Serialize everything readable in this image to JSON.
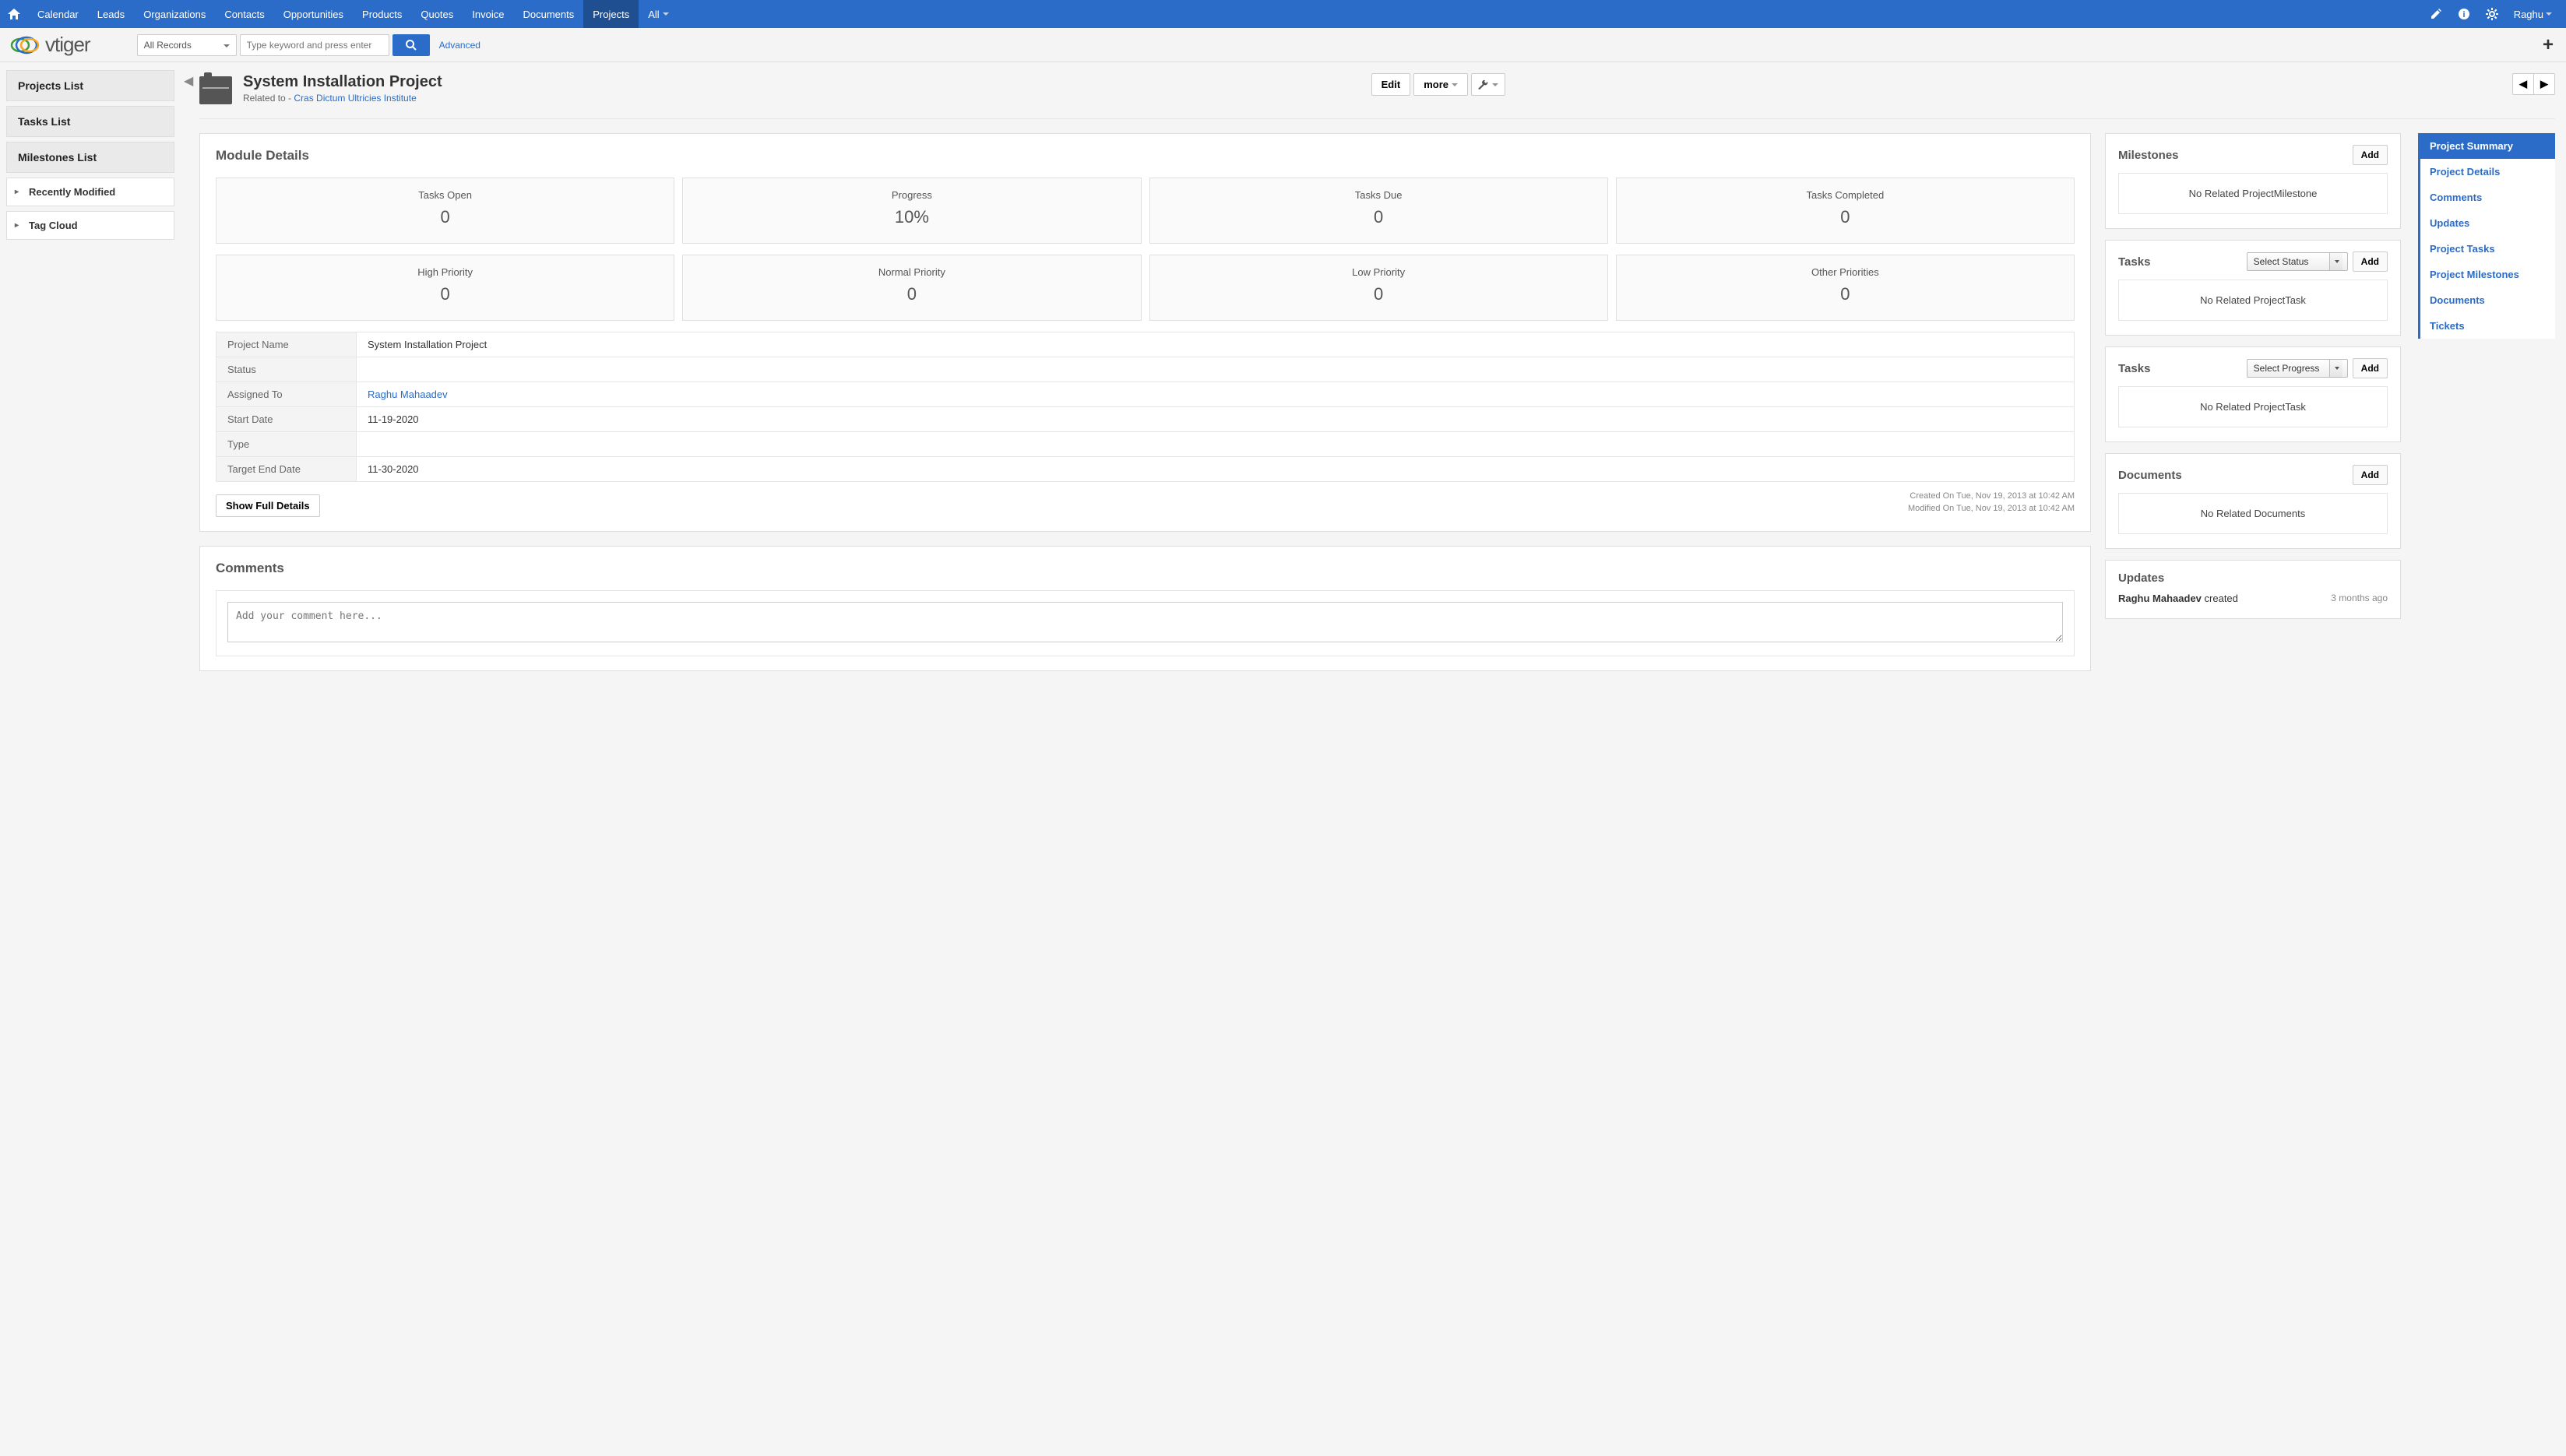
{
  "topnav": {
    "items": [
      "Calendar",
      "Leads",
      "Organizations",
      "Contacts",
      "Opportunities",
      "Products",
      "Quotes",
      "Invoice",
      "Documents",
      "Projects",
      "All"
    ],
    "active": 9,
    "user": "Raghu"
  },
  "header": {
    "logo_text": "vtiger",
    "records_select": "All Records",
    "search_placeholder": "Type keyword and press enter",
    "advanced": "Advanced"
  },
  "left_sidebar": {
    "lists": [
      "Projects List",
      "Tasks List",
      "Milestones List"
    ],
    "accordions": [
      "Recently Modified",
      "Tag Cloud"
    ]
  },
  "record": {
    "title": "System Installation Project",
    "related_prefix": "Related to - ",
    "related_to": "Cras Dictum Ultricies Institute",
    "edit": "Edit",
    "more": "more"
  },
  "module_details": {
    "title": "Module Details",
    "stats1": [
      {
        "label": "Tasks Open",
        "value": "0"
      },
      {
        "label": "Progress",
        "value": "10%"
      },
      {
        "label": "Tasks Due",
        "value": "0"
      },
      {
        "label": "Tasks Completed",
        "value": "0"
      }
    ],
    "stats2": [
      {
        "label": "High Priority",
        "value": "0"
      },
      {
        "label": "Normal Priority",
        "value": "0"
      },
      {
        "label": "Low Priority",
        "value": "0"
      },
      {
        "label": "Other Priorities",
        "value": "0"
      }
    ],
    "fields": [
      {
        "k": "Project Name",
        "v": "System Installation Project",
        "link": false
      },
      {
        "k": "Status",
        "v": "",
        "link": false
      },
      {
        "k": "Assigned To",
        "v": "Raghu Mahaadev",
        "link": true
      },
      {
        "k": "Start Date",
        "v": "11-19-2020",
        "link": false
      },
      {
        "k": "Type",
        "v": "",
        "link": false
      },
      {
        "k": "Target End Date",
        "v": "11-30-2020",
        "link": false
      }
    ],
    "show_full": "Show Full Details",
    "created": "Created On Tue, Nov 19, 2013 at 10:42 AM",
    "modified": "Modified On Tue, Nov 19, 2013 at 10:42 AM"
  },
  "comments": {
    "title": "Comments",
    "placeholder": "Add your comment here..."
  },
  "side_panels": {
    "milestones": {
      "title": "Milestones",
      "add": "Add",
      "empty": "No Related ProjectMilestone"
    },
    "tasks_status": {
      "title": "Tasks",
      "select": "Select Status",
      "add": "Add",
      "empty": "No Related ProjectTask"
    },
    "tasks_progress": {
      "title": "Tasks",
      "select": "Select Progress",
      "add": "Add",
      "empty": "No Related ProjectTask"
    },
    "documents": {
      "title": "Documents",
      "add": "Add",
      "empty": "No Related Documents"
    },
    "updates": {
      "title": "Updates",
      "who": "Raghu Mahaadev",
      "action": " created",
      "when": "3 months ago"
    }
  },
  "right_nav": {
    "items": [
      "Project Summary",
      "Project Details",
      "Comments",
      "Updates",
      "Project Tasks",
      "Project Milestones",
      "Documents",
      "Tickets"
    ],
    "active": 0
  }
}
